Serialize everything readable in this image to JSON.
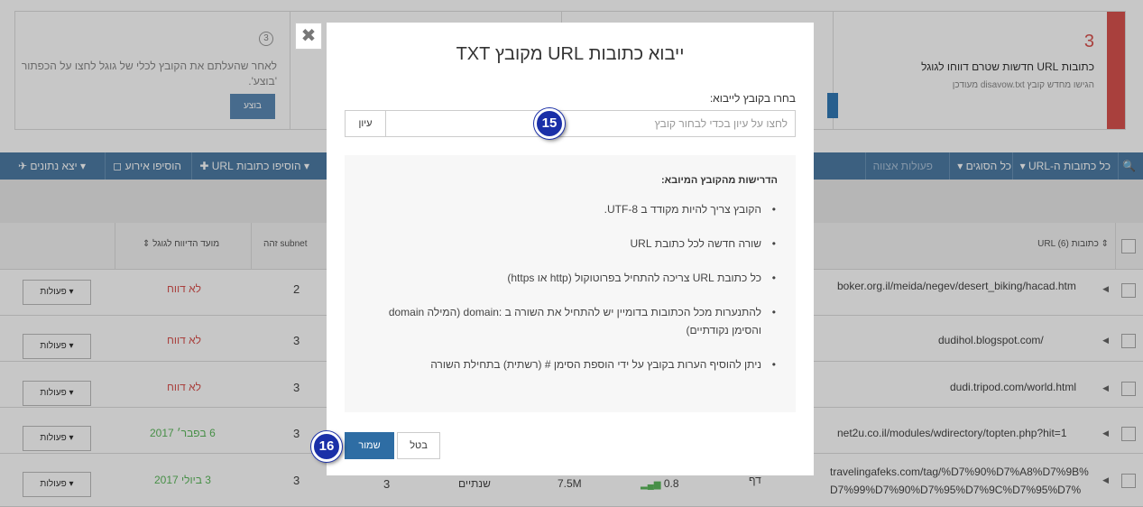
{
  "stats": {
    "count": "3",
    "title": "כתובות URL חדשות שטרם דווחו לגוגל",
    "subtitle": "הגישו מחדש קובץ disavow.txt מעודכן",
    "step_number": "3",
    "left_text": "לאחר שהעלתם את הקובץ לכלי של גוגל לחצו על הכפתור 'בוצע'.",
    "done_label": "בוצע"
  },
  "toolbar": {
    "export_label": "יצא נתונים",
    "add_event_label": "הוסיפו אירוע",
    "add_urls_label": "הוסיפו כתובות URL",
    "mass_actions_label": "פעולות אצווה",
    "all_types_label": "כל הסוגים",
    "all_urls_label": "כל כתובות ה-URL"
  },
  "table": {
    "headers": {
      "urls": "כתובות URL (6)",
      "subnet": "subnet זהה",
      "report_date": "מועד הדיווח לגוגל"
    },
    "rows": [
      {
        "url": "boker.org.il/meida/negev/desert_biking/hacad.htm",
        "subnet": "2",
        "status": "לא דווח",
        "actions": "פעולות"
      },
      {
        "url": "dudihol.blogspot.com/",
        "subnet": "3",
        "status": "לא דווח",
        "actions": "פעולות"
      },
      {
        "url": "dudi.tripod.com/world.html",
        "subnet": "3",
        "status": "לא דווח",
        "actions": "פעולות"
      },
      {
        "url": "net2u.co.il/modules/wdirectory/topten.php?hit=1",
        "subnet": "3",
        "status": "6 בפבר׳ 2017",
        "actions": "פעולות"
      },
      {
        "url": "travelingafeks.com/tag/%D7%90%D7%A8%D7%9B%D7%99%D7%90%D7%95%D7%9C%D7%95%D7%",
        "subnet": "3",
        "status": "3 ביולי 2017",
        "actions": "פעולות",
        "col_a": "3",
        "col_b": "שנתיים",
        "col_c": "7.5M",
        "col_d": "0.8",
        "col_e": "דף"
      }
    ]
  },
  "modal": {
    "title": "ייבוא כתובות URL מקובץ TXT",
    "choose_label": "בחרו בקובץ לייבוא:",
    "file_placeholder": "לחצו על עיון בכדי לבחור קובץ",
    "browse_label": "עיון",
    "requirements_title": "הדרישות מהקובץ המיובא:",
    "requirements": [
      "הקובץ צריך להיות מקודד ב UTF-8.",
      "שורה חדשה לכל כתובת URL",
      "כל כתובת URL צריכה להתחיל בפרוטוקול (http או https)",
      "להתנערות מכל הכתובות בדומיין יש להתחיל את השורה ב :domain (המילה domain והסימן נקודתיים)",
      "ניתן להוסיף הערות בקובץ על ידי הוספת הסימן # (רשתית) בתחילת השורה"
    ],
    "save_label": "שמור",
    "cancel_label": "בטל",
    "close_symbol": "✖"
  },
  "annotations": {
    "badge_1": "15",
    "badge_2": "16"
  },
  "colors": {
    "accent": "#2e6da4",
    "toolbar": "#4d7ca5",
    "alert": "#d9534f",
    "badge": "#1a2fa8"
  }
}
